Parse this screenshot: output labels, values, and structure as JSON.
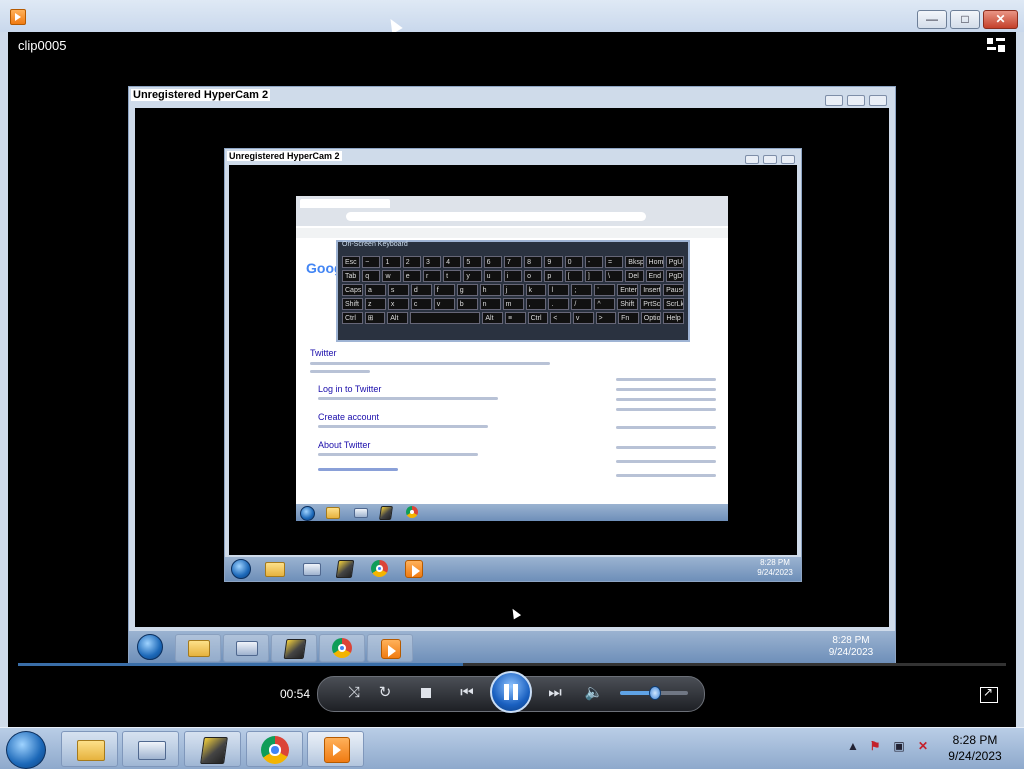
{
  "window": {
    "clip_title": "clip0005",
    "buttons": {
      "minimize": "—",
      "maximize": "□",
      "close": "✕"
    }
  },
  "nested_windows": [
    {
      "title": "Unregistered HyperCam 2"
    },
    {
      "title": "Unregistered HyperCam 2"
    }
  ],
  "inner_screen": {
    "osk_title": "On-Screen Keyboard",
    "osk_rows": [
      [
        "Esc",
        "~",
        "1",
        "2",
        "3",
        "4",
        "5",
        "6",
        "7",
        "8",
        "9",
        "0",
        "-",
        "=",
        "Bksp",
        "Home",
        "PgUp"
      ],
      [
        "Tab",
        "q",
        "w",
        "e",
        "r",
        "t",
        "y",
        "u",
        "i",
        "o",
        "p",
        "[",
        "]",
        "\\",
        "Del",
        "End",
        "PgDn"
      ],
      [
        "Caps",
        "a",
        "s",
        "d",
        "f",
        "g",
        "h",
        "j",
        "k",
        "l",
        ";",
        "'",
        "Enter",
        "Insert",
        "Pause"
      ],
      [
        "Shift",
        "z",
        "x",
        "c",
        "v",
        "b",
        "n",
        "m",
        ",",
        ".",
        "/",
        "^",
        "Shift",
        "PrtScn",
        "ScrLk"
      ],
      [
        "Ctrl",
        "⊞",
        "Alt",
        "",
        "Alt",
        "≡",
        "Ctrl",
        "<",
        "v",
        ">",
        "Fn",
        "Options",
        "Help"
      ]
    ],
    "google_logo": "Google",
    "links": [
      "Twitter",
      "Log in to Twitter",
      "Create account",
      "About Twitter"
    ]
  },
  "player": {
    "elapsed": "00:54",
    "progress": 0.45,
    "volume": 0.5
  },
  "taskbar": {
    "clock_time": "8:28 PM",
    "clock_date": "9/24/2023",
    "apps": [
      "Windows Explorer",
      "On-Screen Keyboard",
      "HyperCam",
      "Google Chrome",
      "Media Player"
    ]
  },
  "mini_clocks": [
    {
      "time": "8:28 PM",
      "date": "9/24/2023"
    },
    {
      "time": "8:28 PM",
      "date": "9/24/2023"
    }
  ],
  "colors": {
    "accent": "#3a6ea8",
    "taskbar": "#9fb6d6"
  }
}
